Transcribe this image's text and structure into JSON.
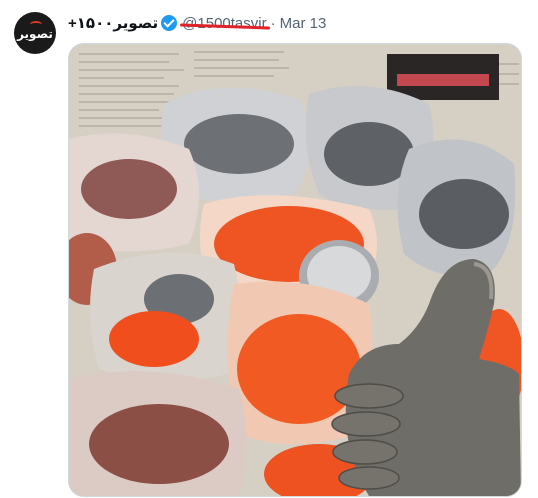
{
  "tweet": {
    "author": {
      "display_name": "تصویر۱۵۰۰+",
      "handle": "@1500tasvir",
      "avatar_text": "تصویر",
      "verified": true,
      "verified_icon": "verified-badge-icon"
    },
    "separator": "·",
    "date": "Mar 13",
    "media": {
      "kind": "photo",
      "subject": "powdered pigments in plastic bags on newspaper, thumbs up from a paint-coated hand"
    }
  },
  "colors": {
    "verified_blue": "#1d9bf0",
    "redaction_red": "#e0222b",
    "secondary_text": "#536471",
    "border": "#cfd9de"
  }
}
